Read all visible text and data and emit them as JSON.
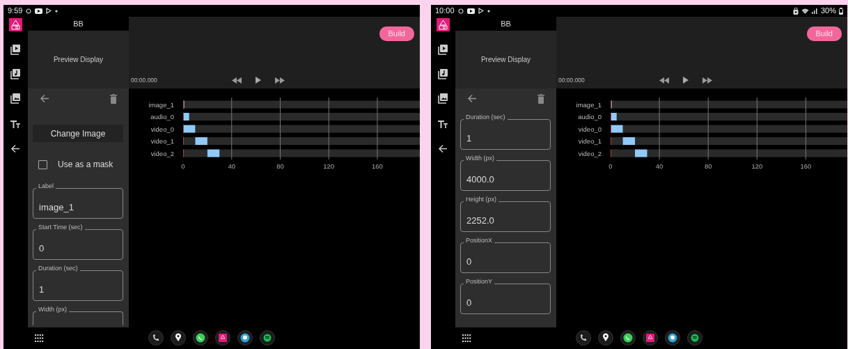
{
  "screens": [
    {
      "status_bar": {
        "time": "9:59"
      },
      "app_title": "BB",
      "preview": "Preview Display",
      "build_button": "Build",
      "timecode": "00:00.000",
      "timeline": {
        "chart_data": {
          "type": "bar",
          "orientation": "horizontal",
          "stacked": true,
          "categories": [
            "image_1",
            "audio_0",
            "video_0",
            "video_1",
            "video_2"
          ],
          "series": [
            {
              "color": "#2a2a2a",
              "values": [
                0,
                0,
                0,
                10,
                20
              ]
            },
            {
              "color": "#90caf9",
              "values": [
                1,
                5,
                10,
                10,
                10
              ]
            }
          ],
          "xticks": [
            0,
            40,
            80,
            120,
            160
          ],
          "xlim": [
            0,
            195
          ],
          "grid": true
        }
      },
      "editor": {
        "change_image_button": "Change Image",
        "mask_checkbox": {
          "label": "Use as a mask",
          "checked": false
        },
        "fields": [
          {
            "label": "Label",
            "value": "image_1"
          },
          {
            "label": "Start Time (sec)",
            "value": "0"
          },
          {
            "label": "Duration (sec)",
            "value": "1"
          },
          {
            "label": "Width (px)"
          }
        ]
      }
    },
    {
      "status_bar": {
        "time": "10:00",
        "battery": "30%"
      },
      "app_title": "BB",
      "preview": "Preview Display",
      "build_button": "Build",
      "timecode": "00:00.000",
      "timeline": {
        "chart_data": {
          "type": "bar",
          "orientation": "horizontal",
          "stacked": true,
          "categories": [
            "image_1",
            "audio_0",
            "video_0",
            "video_1",
            "video_2"
          ],
          "series": [
            {
              "color": "#2a2a2a",
              "values": [
                0,
                0,
                0,
                10,
                20
              ]
            },
            {
              "color": "#90caf9",
              "values": [
                1,
                5,
                10,
                10,
                10
              ]
            }
          ],
          "xticks": [
            0,
            40,
            80,
            120,
            160
          ],
          "xlim": [
            0,
            194
          ],
          "grid": true
        }
      },
      "editor": {
        "fields": [
          {
            "label": "Duration (sec)",
            "value": "1"
          },
          {
            "label": "Width (px)",
            "value": "4000.0"
          },
          {
            "label": "Height (px)",
            "value": "2252.0"
          },
          {
            "label": "PositionX",
            "value": "0"
          },
          {
            "label": "PositionY",
            "value": "0"
          }
        ]
      }
    }
  ]
}
